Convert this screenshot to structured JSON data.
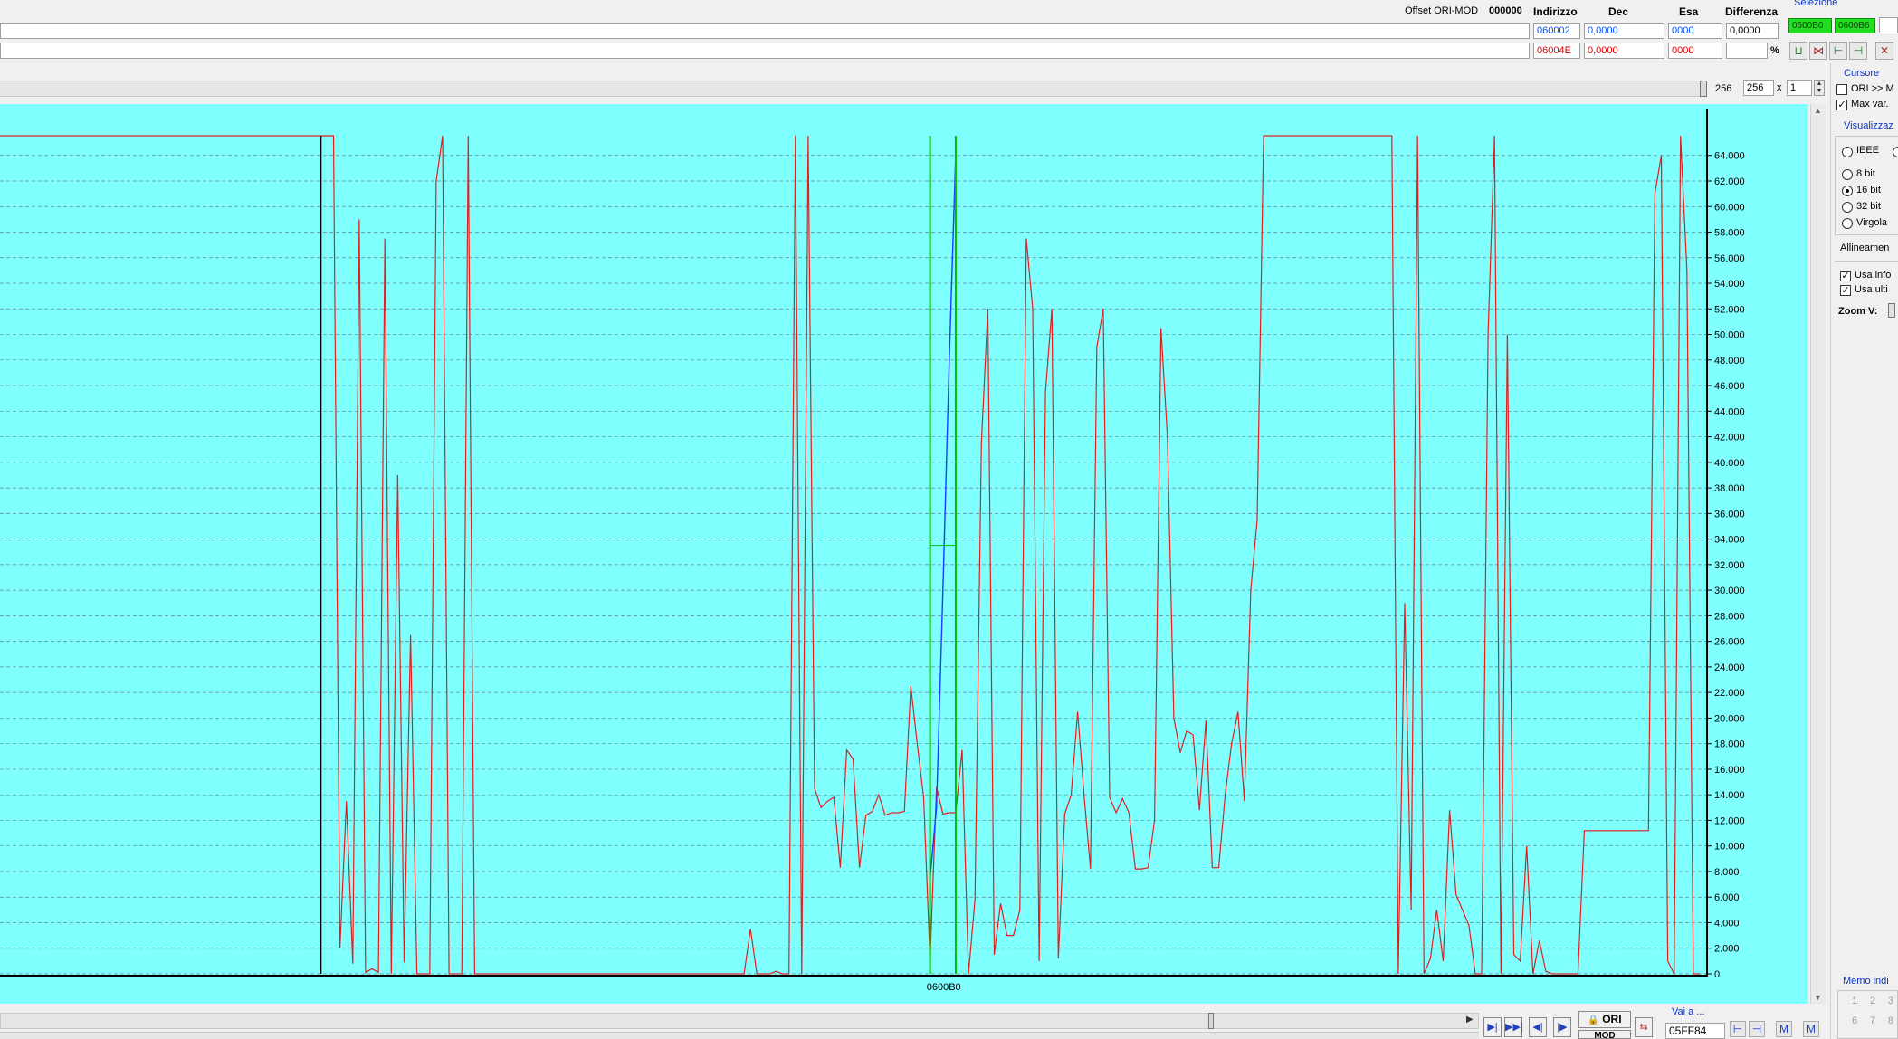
{
  "header": {
    "offset_label": "Offset ORI-MOD",
    "offset_value": "000000",
    "col_indirizzo": "Indirizzo",
    "col_dec": "Dec",
    "col_esa": "Esa",
    "col_differenza": "Differenza",
    "row1": {
      "address": "060002",
      "dec": "0,0000",
      "esa": "0000",
      "diff": "0,0000"
    },
    "row2": {
      "address": "06004E",
      "dec": "0,0000",
      "esa": "0000",
      "diff": ""
    },
    "percent": "%"
  },
  "selezione": {
    "title": "Selezione",
    "start": "0600B0",
    "end": "0600B6"
  },
  "zoom_bar": {
    "width_value": "256",
    "width_input": "256",
    "times": "x",
    "multiplier": "1"
  },
  "cursore": {
    "title": "Cursore",
    "ori_mod_label": "ORI >> M",
    "ori_mod_checked": false,
    "max_var_label": "Max var.",
    "max_var_checked": true
  },
  "visualizza": {
    "title": "Visualizzaz",
    "options": [
      {
        "label": "IEEE",
        "selected": false
      },
      {
        "label": "8 bit",
        "selected": false
      },
      {
        "label": "16 bit",
        "selected": true
      },
      {
        "label": "32 bit",
        "selected": false
      },
      {
        "label": "Virgola",
        "selected": false
      }
    ],
    "allineamento": "Allineamen",
    "usa_info": "Usa info",
    "usa_ulti": "Usa ulti",
    "zoom_v": "Zoom V:"
  },
  "memo": {
    "title": "Memo indi",
    "numbers": [
      "1",
      "2",
      "3",
      "6",
      "7",
      "8"
    ]
  },
  "bottom": {
    "vai_a": "Vai a ...",
    "address": "05FF84",
    "ori_button": "ORI",
    "mod_button": "MOD"
  },
  "colors": {
    "plot_bg": "#80ffff",
    "ori_line": "#e02020",
    "mod_line": "#1a3cff",
    "selection": "#00c000",
    "selezione_bg": "#22dd22"
  },
  "chart_data": {
    "type": "line",
    "title": "",
    "xlabel": "0600B0",
    "ylabel": "",
    "ylim": [
      0,
      65536
    ],
    "y_ticks": [
      "0",
      "2.000",
      "4.000",
      "6.000",
      "8.000",
      "10.000",
      "12.000",
      "14.000",
      "16.000",
      "18.000",
      "20.000",
      "22.000",
      "24.000",
      "26.000",
      "28.000",
      "30.000",
      "32.000",
      "34.000",
      "36.000",
      "38.000",
      "40.000",
      "42.000",
      "44.000",
      "46.000",
      "48.000",
      "50.000",
      "52.000",
      "54.000",
      "56.000",
      "58.000",
      "60.000",
      "62.000",
      "64.000"
    ],
    "grid": true,
    "marker_index": 50,
    "selection_index_range": [
      145,
      149
    ],
    "series": [
      {
        "values": [
          65535,
          65535,
          65535,
          65535,
          65535,
          65535,
          65535,
          65535,
          65535,
          65535,
          65535,
          65535,
          65535,
          65535,
          65535,
          65535,
          65535,
          65535,
          65535,
          65535,
          65535,
          65535,
          65535,
          65535,
          65535,
          65535,
          65535,
          65535,
          65535,
          65535,
          65535,
          65535,
          65535,
          65535,
          65535,
          65535,
          65535,
          65535,
          65535,
          65535,
          65535,
          65535,
          65535,
          65535,
          65535,
          65535,
          65535,
          65535,
          65535,
          65535,
          65535,
          65535,
          65535,
          2000,
          13500,
          800,
          59000,
          100,
          400,
          100,
          57500,
          0,
          39000,
          900,
          26500,
          0,
          0,
          0,
          62000,
          65535,
          0,
          0,
          0,
          65535,
          0,
          0,
          0,
          0,
          0,
          0,
          0,
          0,
          0,
          0,
          0,
          0,
          0,
          0,
          0,
          0,
          0,
          0,
          0,
          0,
          0,
          0,
          0,
          0,
          0,
          0,
          0,
          0,
          0,
          0,
          0,
          0,
          0,
          0,
          0,
          0,
          0,
          0,
          0,
          0,
          0,
          0,
          0,
          3500,
          0,
          0,
          0,
          200,
          0,
          0,
          65535,
          0,
          65535,
          14500,
          13000,
          13500,
          13800,
          8300,
          17500,
          16800,
          8300,
          12400,
          12700,
          14000,
          12400,
          12600,
          12600,
          12700,
          22500,
          18000,
          13800,
          1000,
          14600,
          12500,
          12600,
          12600,
          17500,
          0,
          5800,
          41500,
          52000,
          1500,
          5500,
          3000,
          3000,
          5000,
          57500,
          52000,
          1000,
          45500,
          52000,
          1200,
          12500,
          14000,
          20500,
          14000,
          8200,
          49000,
          52000,
          13800,
          12600,
          13700,
          12600,
          8200,
          8200,
          8300,
          12000,
          50500,
          42000,
          20000,
          17300,
          19000,
          18700,
          12800,
          19800,
          8300,
          8300,
          14000,
          18000,
          20500,
          13500,
          30000,
          35500,
          65535,
          65535,
          65535,
          65535,
          65535,
          65535,
          65535,
          65535,
          65535,
          65535,
          65535,
          65535,
          65535,
          65535,
          65535,
          65535,
          65535,
          65535,
          65535,
          65535,
          65535,
          0,
          29000,
          5000,
          65535,
          0,
          1200,
          5000,
          1000,
          12800,
          6200,
          5000,
          3800,
          0,
          0,
          50000,
          65535,
          0,
          50000,
          1500,
          1000,
          10000,
          0,
          2600,
          200,
          0,
          0,
          0,
          0,
          0,
          11200,
          11200,
          11200,
          11200,
          11200,
          11200,
          11200,
          11200,
          11200,
          11200,
          11200,
          61000,
          64000,
          1000,
          0,
          65535,
          55000,
          0,
          0
        ]
      },
      {
        "values": [
          7500,
          13000,
          30000,
          48000,
          64000
        ]
      }
    ]
  }
}
